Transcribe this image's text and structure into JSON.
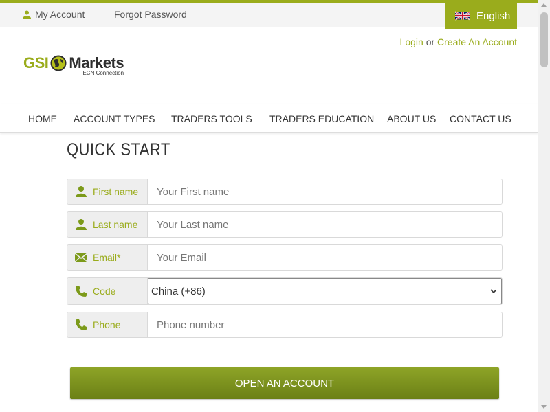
{
  "topbar": {
    "my_account": "My Account",
    "forgot_password": "Forgot Password",
    "language": "English"
  },
  "auth": {
    "login": "Login",
    "or": "or",
    "create": "Create An Account"
  },
  "logo": {
    "gsi": "GSI",
    "markets": "Markets",
    "tagline": "ECN Connection"
  },
  "nav": [
    "HOME",
    "ACCOUNT TYPES",
    "TRADERS TOOLS",
    "TRADERS EDUCATION",
    "ABOUT US",
    "CONTACT US"
  ],
  "form": {
    "title": "QUICK START",
    "fields": [
      {
        "label": "First name",
        "placeholder": "Your First name",
        "icon": "user-icon"
      },
      {
        "label": "Last name",
        "placeholder": "Your Last name",
        "icon": "user-icon"
      },
      {
        "label": "Email*",
        "placeholder": "Your Email",
        "icon": "envelope-icon"
      },
      {
        "label": "Code",
        "value": "China (+86)",
        "icon": "phone-icon"
      },
      {
        "label": "Phone",
        "placeholder": "Phone number",
        "icon": "phone-icon"
      }
    ],
    "submit": "OPEN AN ACCOUNT"
  },
  "colors": {
    "accent": "#9aac1c",
    "button_top": "#8ea427",
    "button_bottom": "#6b8016"
  }
}
